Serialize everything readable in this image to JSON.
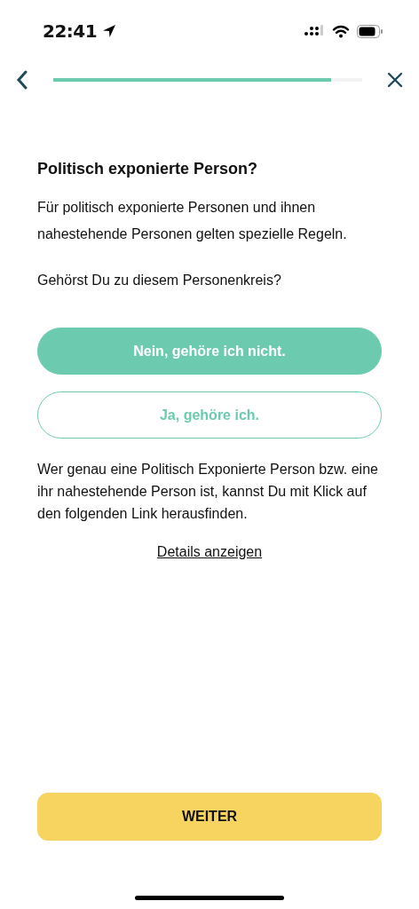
{
  "status_bar": {
    "time": "22:41"
  },
  "progress": {
    "level": 0.9
  },
  "title": "Politisch exponierte Person?",
  "description": "Für politisch exponierte Personen und ihnen nahestehende Personen gelten spezielle Regeln.",
  "question": "Gehörst Du zu diesem Personenkreis?",
  "options": [
    {
      "label": "Nein, gehöre ich nicht.",
      "selected": true
    },
    {
      "label": "Ja, gehöre ich.",
      "selected": false
    }
  ],
  "info": "Wer genau eine Politisch Exponierte Person bzw. eine ihr nahestehende Person ist, kannst Du mit Klick auf den folgenden Link herausfinden.",
  "link": "Details anzeigen",
  "continue_button": "WEITER"
}
